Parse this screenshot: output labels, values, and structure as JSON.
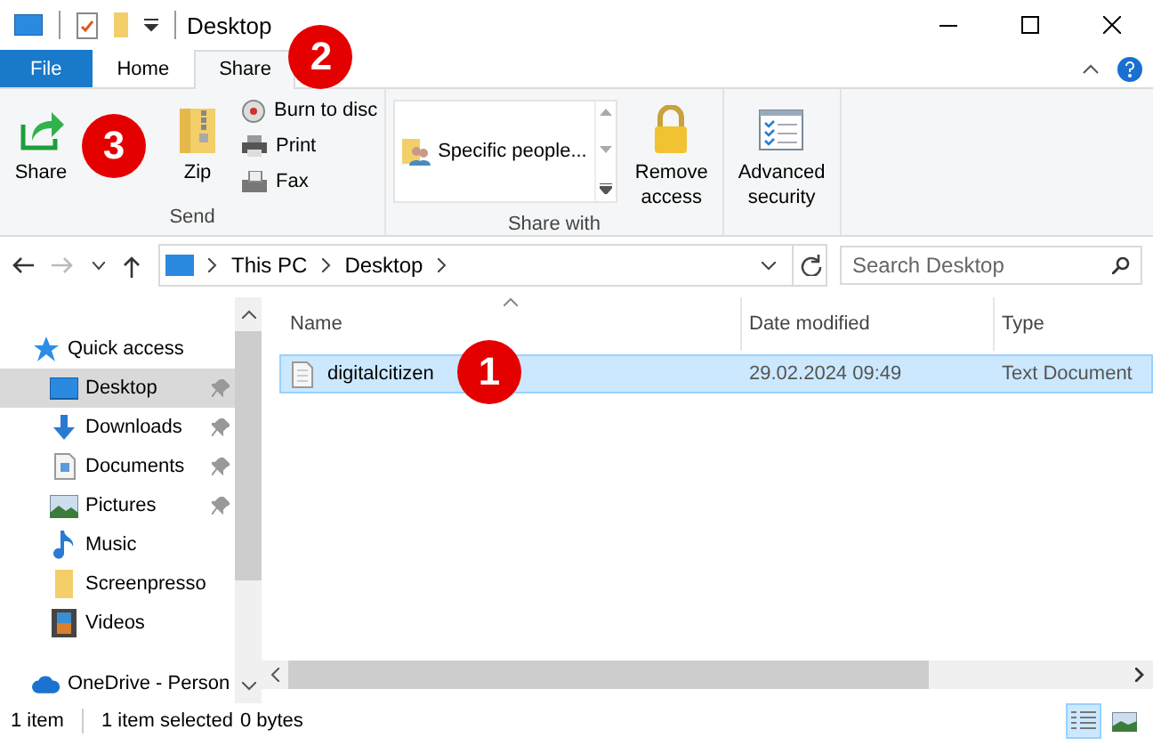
{
  "window": {
    "title": "Desktop"
  },
  "tabs": [
    {
      "label": "File",
      "kind": "file",
      "selected": false
    },
    {
      "label": "Home",
      "kind": "tab",
      "selected": false
    },
    {
      "label": "Share",
      "kind": "tab",
      "selected": true,
      "callout": "2"
    }
  ],
  "ribbon": {
    "groups": [
      {
        "label": "Send",
        "buttons": [
          {
            "kind": "large",
            "label": "Share",
            "callout": "3"
          },
          {
            "kind": "large",
            "label": "Zip"
          },
          {
            "kind": "small",
            "label": "Burn to disc"
          },
          {
            "kind": "small",
            "label": "Print"
          },
          {
            "kind": "small",
            "label": "Fax"
          }
        ]
      },
      {
        "label": "Share with",
        "buttons": [
          {
            "kind": "gallery",
            "label": "Specific people..."
          },
          {
            "kind": "large",
            "label": "Remove access"
          }
        ]
      },
      {
        "buttons": [
          {
            "kind": "large",
            "label": "Advanced security"
          }
        ]
      }
    ]
  },
  "address": {
    "path": [
      "This PC",
      "Desktop"
    ]
  },
  "search": {
    "placeholder": "Search Desktop"
  },
  "sidebar": {
    "items": [
      {
        "label": "Quick access",
        "selected": false,
        "children": [
          {
            "label": "Desktop",
            "selected": true,
            "pinned": true
          },
          {
            "label": "Downloads",
            "selected": false,
            "pinned": true
          },
          {
            "label": "Documents",
            "selected": false,
            "pinned": true
          },
          {
            "label": "Pictures",
            "selected": false,
            "pinned": true
          },
          {
            "label": "Music",
            "selected": false,
            "pinned": false
          },
          {
            "label": "Screenpresso",
            "selected": false,
            "pinned": false
          },
          {
            "label": "Videos",
            "selected": false,
            "pinned": false
          }
        ]
      },
      {
        "label": "OneDrive - Person",
        "selected": false
      }
    ]
  },
  "table": {
    "columns": [
      "Name",
      "Date modified",
      "Type"
    ],
    "rows": [
      {
        "name": "digitalcitizen",
        "date": "29.02.2024 09:49",
        "type": "Text Document",
        "selected": true,
        "callout": "1"
      }
    ]
  },
  "status_bar": {
    "count": "1 item",
    "selection": "1 item selected",
    "size": "0 bytes",
    "views": [
      {
        "kind": "details",
        "selected": true
      },
      {
        "kind": "thumbnails",
        "selected": false
      }
    ]
  }
}
